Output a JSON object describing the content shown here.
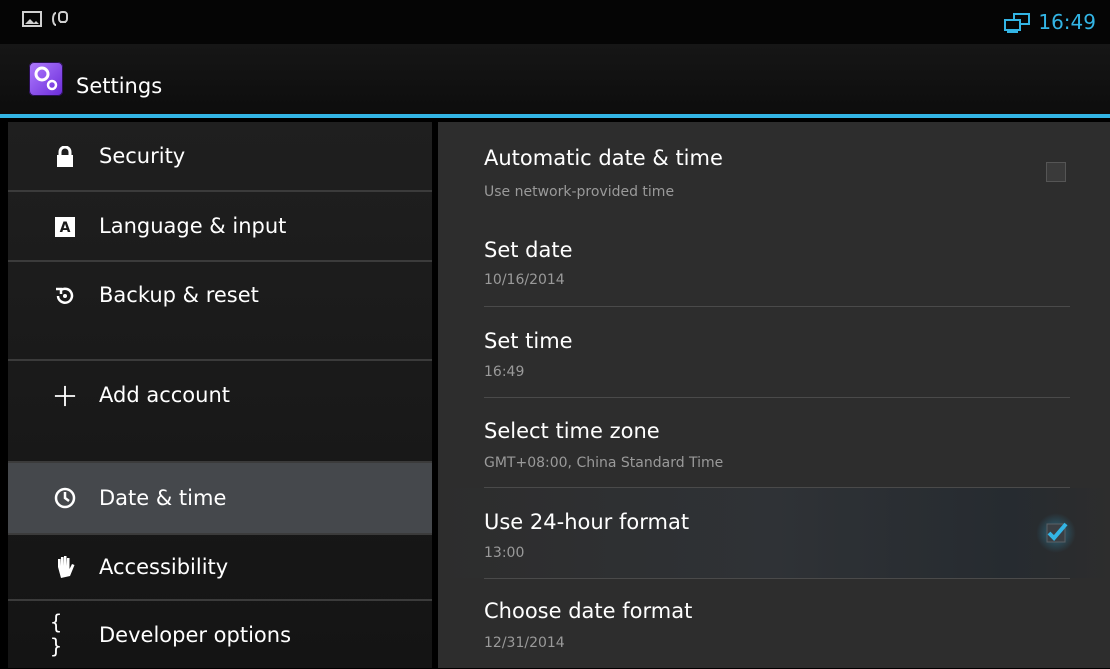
{
  "status_bar": {
    "time": "16:49",
    "left_icons": [
      "gallery-icon",
      "usb-debug-icon"
    ],
    "right_icons": [
      "network-monitor-icon"
    ]
  },
  "action_bar": {
    "title": "Settings"
  },
  "sidebar": {
    "items": [
      {
        "label": "Security",
        "icon": "lock-icon"
      },
      {
        "label": "Language & input",
        "icon": "keyboard-a-icon"
      },
      {
        "label": "Backup & reset",
        "icon": "backup-restore-icon"
      },
      {
        "label": "Add account",
        "icon": "plus-icon"
      },
      {
        "label": "Date & time",
        "icon": "clock-icon",
        "selected": true
      },
      {
        "label": "Accessibility",
        "icon": "hand-icon"
      },
      {
        "label": "Developer options",
        "icon": "braces-icon"
      }
    ]
  },
  "preferences": {
    "items": [
      {
        "title": "Automatic date & time",
        "summary": "Use network-provided time",
        "checkbox": false
      },
      {
        "title": "Set date",
        "summary": "10/16/2014"
      },
      {
        "title": "Set time",
        "summary": "16:49"
      },
      {
        "title": "Select time zone",
        "summary": "GMT+08:00, China Standard Time"
      },
      {
        "title": "Use 24-hour format",
        "summary": "13:00",
        "checkbox": true
      },
      {
        "title": "Choose date format",
        "summary": "12/31/2014"
      }
    ]
  },
  "colors": {
    "accent": "#33b5e5",
    "background": "#2d2d2d",
    "selected": "#45484c"
  }
}
